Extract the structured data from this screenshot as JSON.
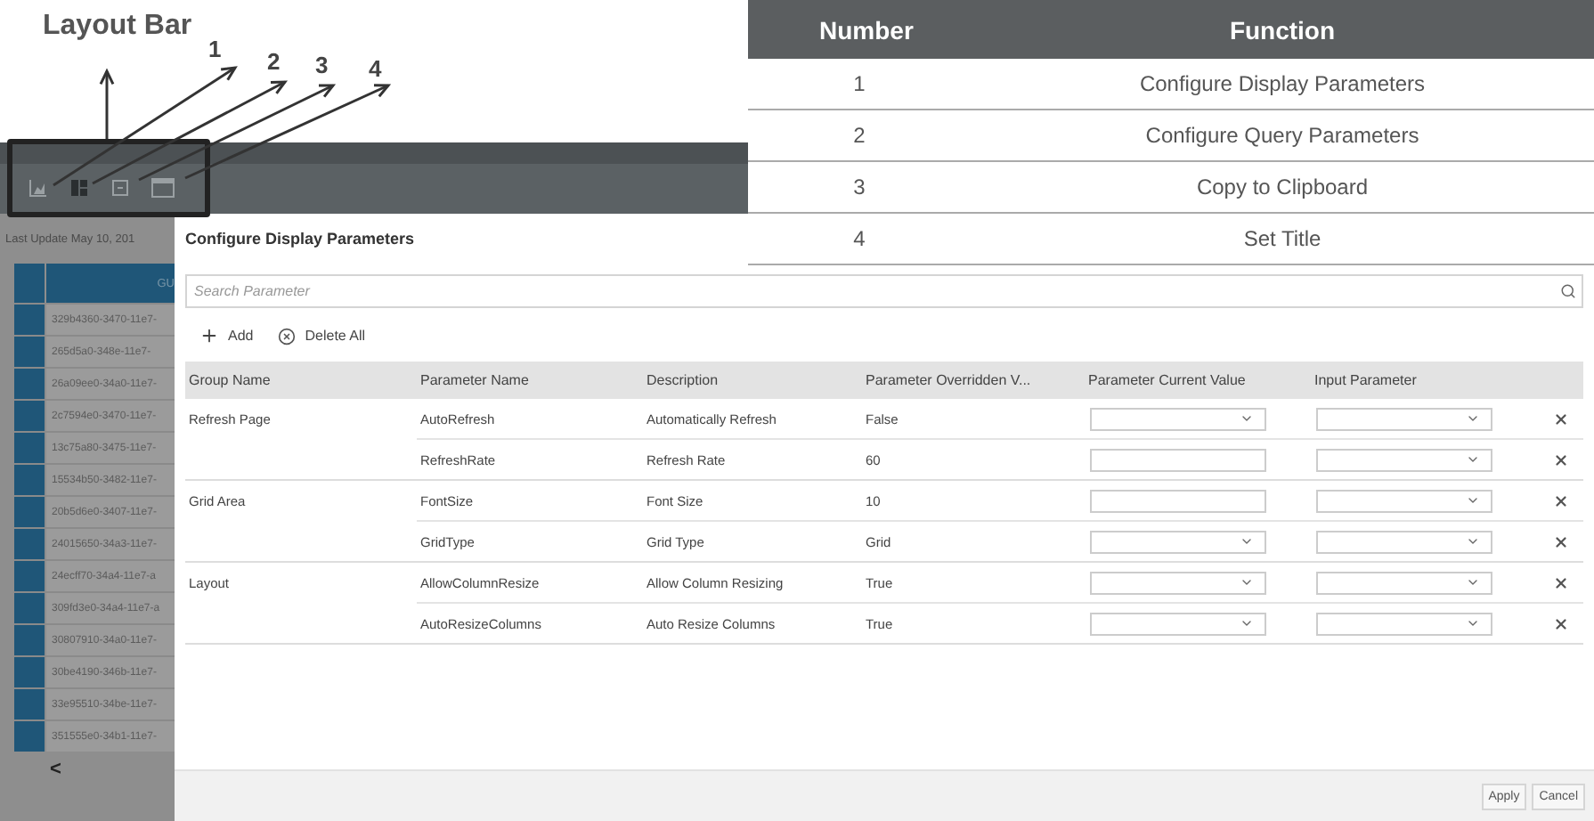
{
  "annotation": {
    "title": "Layout Bar",
    "callouts": [
      "1",
      "2",
      "3",
      "4"
    ]
  },
  "function_table": {
    "columns": [
      "Number",
      "Function"
    ],
    "rows": [
      {
        "number": "1",
        "function": "Configure Display Parameters"
      },
      {
        "number": "2",
        "function": "Configure Query Parameters"
      },
      {
        "number": "3",
        "function": "Copy to Clipboard"
      },
      {
        "number": "4",
        "function": "Set Title"
      }
    ]
  },
  "grid": {
    "last_update": "Last Update May 10, 201",
    "column_header": "GU",
    "rows": [
      "329b4360-3470-11e7-",
      "265d5a0-348e-11e7-",
      "26a09ee0-34a0-11e7-",
      "2c7594e0-3470-11e7-",
      "13c75a80-3475-11e7-",
      "15534b50-3482-11e7-",
      "20b5d6e0-3407-11e7-",
      "24015650-34a3-11e7-",
      "24ecff70-34a4-11e7-a",
      "309fd3e0-34a4-11e7-a",
      "30807910-34a0-11e7-",
      "30be4190-346b-11e7-",
      "33e95510-34be-11e7-",
      "351555e0-34b1-11e7-"
    ],
    "scroll_button": "<"
  },
  "dialog": {
    "title": "Configure Display Parameters",
    "search": {
      "placeholder": "Search Parameter"
    },
    "actions": [
      {
        "kind": "add",
        "label": "Add"
      },
      {
        "kind": "delete",
        "label": "Delete All"
      }
    ],
    "columns": [
      "Group Name",
      "Parameter Name",
      "Description",
      "Parameter Overridden V...",
      "Parameter Current Value",
      "Input Parameter"
    ],
    "groups": [
      {
        "name": "Refresh Page",
        "parameters": [
          {
            "name": "AutoRefresh",
            "description": "Automatically Refresh",
            "overridden": "False",
            "kind": "select"
          },
          {
            "name": "RefreshRate",
            "description": "Refresh Rate",
            "overridden": "60",
            "kind": "text"
          }
        ]
      },
      {
        "name": "Grid Area",
        "parameters": [
          {
            "name": "FontSize",
            "description": "Font Size",
            "overridden": "10",
            "kind": "text"
          },
          {
            "name": "GridType",
            "description": "Grid Type",
            "overridden": "Grid",
            "kind": "select"
          }
        ]
      },
      {
        "name": "Layout",
        "parameters": [
          {
            "name": "AllowColumnResize",
            "description": "Allow Column Resizing",
            "overridden": "True",
            "kind": "select"
          },
          {
            "name": "AutoResizeColumns",
            "description": "Auto Resize Columns",
            "overridden": "True",
            "kind": "select"
          }
        ]
      }
    ],
    "buttons": [
      "Apply",
      "Cancel"
    ]
  }
}
